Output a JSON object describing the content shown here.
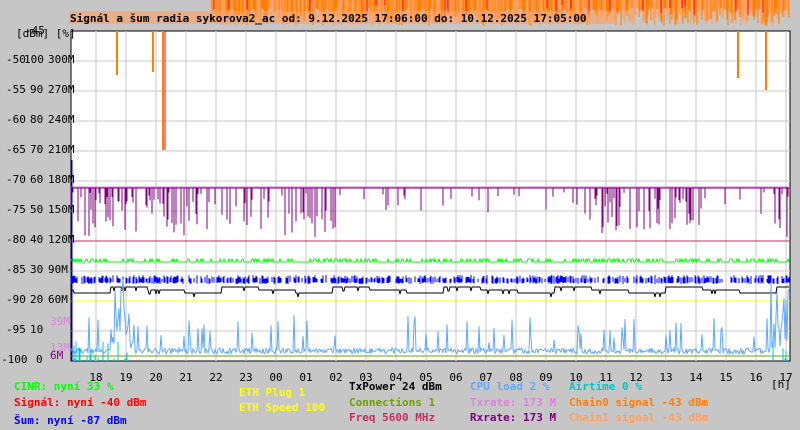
{
  "chart_data": {
    "type": "line",
    "title": "Signál a šum radia sykorova2_ac od: 9.12.2025 17:06:00 do: 10.12.2025 17:05:00",
    "y_units_label": "[dBm] [%]",
    "x_unit_label": "[h]",
    "x_ticks": [
      "18",
      "19",
      "20",
      "21",
      "22",
      "23",
      "00",
      "01",
      "02",
      "03",
      "04",
      "05",
      "06",
      "07",
      "08",
      "09",
      "10",
      "11",
      "12",
      "13",
      "14",
      "15",
      "16",
      "17"
    ],
    "y_ticks_dbm": [
      "-45",
      "-50",
      "-55",
      "-60",
      "-65",
      "-70",
      "-75",
      "-80",
      "-85",
      "-90",
      "-95",
      "-100"
    ],
    "y_ticks_pct": [
      "100",
      "90",
      "80",
      "70",
      "60",
      "50",
      "40",
      "30",
      "20",
      "10",
      "0"
    ],
    "y_ticks_rate": [
      "300M",
      "270M",
      "240M",
      "210M",
      "180M",
      "150M",
      "120M",
      "90M",
      "60M"
    ],
    "y_extra_labels": [
      {
        "text": "39M",
        "color": "#e080e0"
      },
      {
        "text": "13M",
        "color": "#e080e0"
      },
      {
        "text": "6M",
        "color": "#800080"
      }
    ],
    "ylim_dbm": [
      -100,
      -45
    ],
    "grid": true,
    "series": [
      {
        "name": "Signál",
        "color": "#ff0000",
        "level_dbm": -40
      },
      {
        "name": "Šum",
        "color": "#0000ff",
        "level_dbm": -87
      },
      {
        "name": "CINR",
        "color": "#00ff00",
        "level_pct": 33
      },
      {
        "name": "Rxrate",
        "color": "#800080",
        "level_M": 173
      },
      {
        "name": "Txrate",
        "color": "#e080e0",
        "level_M": 173
      },
      {
        "name": "Chain0 signal",
        "color": "#ff8000",
        "level_dbm": -43
      },
      {
        "name": "Chain1 signal",
        "color": "#ffa060",
        "level_dbm": -43
      },
      {
        "name": "CPU load",
        "color": "#60a8ff",
        "level_pct": 2
      },
      {
        "name": "Airtime",
        "color": "#00c8c8",
        "level_pct": 0
      },
      {
        "name": "TxPower",
        "color": "#000000",
        "level_dbm": -88
      },
      {
        "name": "ETH Speed",
        "color": "#ffff00",
        "level_M": 60
      },
      {
        "name": "Freq",
        "color": "#c03060",
        "level_dbm": -80
      },
      {
        "name": "Connections",
        "color": "#70a000",
        "level_pct": 1.5
      }
    ]
  },
  "legend": {
    "cinr": "CINR: nyní 33 %",
    "signal": "Signál: nyní -40 dBm",
    "noise": "Šum: nyní -87 dBm",
    "eth_plug": "ETH Plug 1",
    "eth_speed": "ETH Speed 100",
    "txpower": "TxPower 24 dBm",
    "connections": "Connections 1",
    "freq": "Freq 5600 MHz",
    "cpu": "CPU load 2 %",
    "txrate": "Txrate: 173 M",
    "rxrate": "Rxrate: 173 M",
    "airtime": "Airtime 0 %",
    "chain0": "Chain0 signal -43 dBm",
    "chain1": "Chain1 signal -43 dBm"
  }
}
